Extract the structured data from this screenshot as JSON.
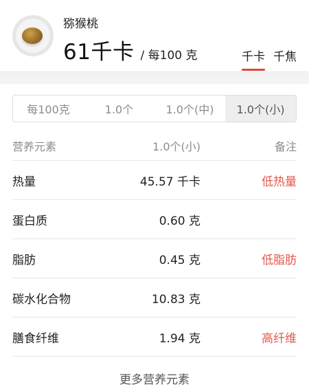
{
  "food": {
    "name": "猕猴桃",
    "calorie_value": "61千卡",
    "per_label": "/ 每100 克",
    "image_icon": "kiwi-fruit-icon"
  },
  "unit_tabs": [
    {
      "label": "千卡",
      "active": true
    },
    {
      "label": "千焦",
      "active": false
    }
  ],
  "serving_options": [
    {
      "label": "每100克",
      "active": false
    },
    {
      "label": "1.0个",
      "active": false
    },
    {
      "label": "1.0个(中)",
      "active": false
    },
    {
      "label": "1.0个(小)",
      "active": true
    }
  ],
  "table": {
    "headers": {
      "name": "营养元素",
      "value": "1.0个(小)",
      "note": "备注"
    },
    "rows": [
      {
        "name": "热量",
        "value": "45.57 千卡",
        "note": "低热量"
      },
      {
        "name": "蛋白质",
        "value": "0.60 克",
        "note": ""
      },
      {
        "name": "脂肪",
        "value": "0.45 克",
        "note": "低脂肪"
      },
      {
        "name": "碳水化合物",
        "value": "10.83 克",
        "note": ""
      },
      {
        "name": "膳食纤维",
        "value": "1.94 克",
        "note": "高纤维"
      }
    ]
  },
  "more_link": "更多营养元素",
  "colors": {
    "accent": "#e0453a",
    "note": "#e25a4d",
    "muted": "#8c8c8c"
  }
}
